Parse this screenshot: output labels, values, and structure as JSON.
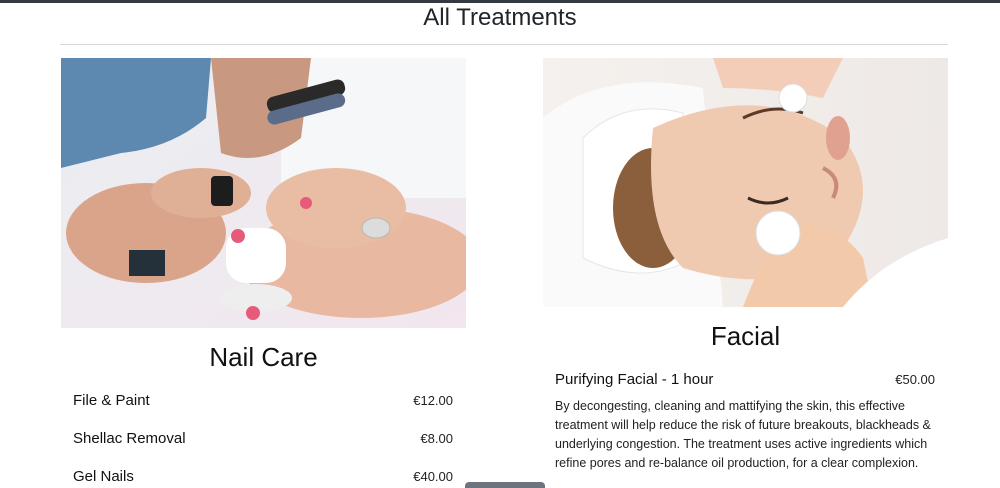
{
  "page": {
    "title": "All Treatments"
  },
  "nail_care": {
    "title": "Nail Care",
    "image_icon": "nail-painting-photo",
    "items": [
      {
        "name": "File & Paint",
        "price": "€12.00"
      },
      {
        "name": "Shellac Removal",
        "price": "€8.00"
      },
      {
        "name": "Gel Nails",
        "price": "€40.00"
      }
    ]
  },
  "facial": {
    "title": "Facial",
    "image_icon": "facial-treatment-photo",
    "items": [
      {
        "name": "Purifying Facial - 1 hour",
        "price": "€50.00",
        "description": "By decongesting, cleaning and mattifying the skin, this effective treatment will help reduce the risk of future breakouts, blackheads & underlying congestion. The treatment uses active ingredients which refine pores and re-balance oil production, for a clear complexion."
      }
    ]
  },
  "colors": {
    "topbar": "#343a40",
    "rule": "#d8d8d8",
    "button": "#6c757d"
  }
}
